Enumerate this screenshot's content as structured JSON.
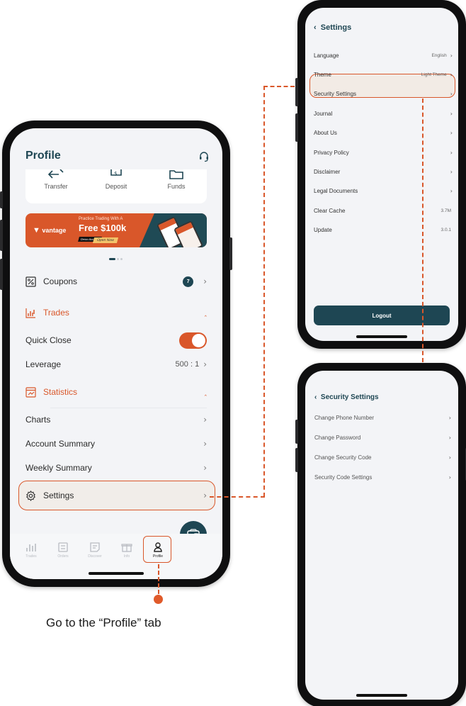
{
  "caption": "Go to the “Profile” tab",
  "colors": {
    "accent": "#d9572a",
    "primary": "#1e4653",
    "background": "#f3f4f7"
  },
  "profile_screen": {
    "title": "Profile",
    "header_icon": "headset-icon",
    "quick_actions": [
      {
        "label": "Transfer",
        "icon": "transfer-icon"
      },
      {
        "label": "Deposit",
        "icon": "deposit-icon"
      },
      {
        "label": "Funds",
        "icon": "funds-icon"
      }
    ],
    "banner": {
      "brand": "vantage",
      "line1": "Practice Trading With A",
      "line2": "Free $100k",
      "tag": "Demo Account",
      "cta": "Open Now",
      "pagination": {
        "current": 1,
        "total": 3
      }
    },
    "coupons": {
      "label": "Coupons",
      "count": "7"
    },
    "trades_section": {
      "label": "Trades",
      "items": [
        {
          "label": "Quick Close",
          "type": "toggle",
          "on": true
        },
        {
          "label": "Leverage",
          "value": "500 : 1"
        }
      ]
    },
    "statistics_section": {
      "label": "Statistics",
      "items": [
        {
          "label": "Charts"
        },
        {
          "label": "Account Summary"
        },
        {
          "label": "Weekly Summary"
        }
      ]
    },
    "settings": {
      "label": "Settings",
      "highlighted": true
    },
    "tabbar": [
      {
        "label": "Trades",
        "icon": "bar-chart-icon"
      },
      {
        "label": "Orders",
        "icon": "orders-icon"
      },
      {
        "label": "Discover",
        "icon": "discover-icon"
      },
      {
        "label": "Info",
        "icon": "gift-icon"
      },
      {
        "label": "Profile",
        "icon": "person-icon",
        "active": true
      }
    ],
    "fab_icon": "wallet-icon"
  },
  "settings_screen": {
    "title": "Settings",
    "items": [
      {
        "label": "Language",
        "value": "English",
        "chevron": true
      },
      {
        "label": "Theme",
        "value": "Light Theme",
        "chevron": true
      },
      {
        "label": "Security Settings",
        "value": "",
        "chevron": true,
        "highlighted": true
      },
      {
        "label": "Journal",
        "value": "",
        "chevron": true
      },
      {
        "label": "About Us",
        "value": "",
        "chevron": true
      },
      {
        "label": "Privacy Policy",
        "value": "",
        "chevron": true
      },
      {
        "label": "Disclaimer",
        "value": "",
        "chevron": true
      },
      {
        "label": "Legal Documents",
        "value": "",
        "chevron": true
      },
      {
        "label": "Clear Cache",
        "value": "3.7M",
        "chevron": false
      },
      {
        "label": "Update",
        "value": "3.0.1",
        "chevron": false
      }
    ],
    "logout_label": "Logout"
  },
  "security_screen": {
    "title": "Security Settings",
    "items": [
      {
        "label": "Change Phone Number"
      },
      {
        "label": "Change Password"
      },
      {
        "label": "Change Security Code"
      },
      {
        "label": "Security Code Settings"
      }
    ]
  }
}
